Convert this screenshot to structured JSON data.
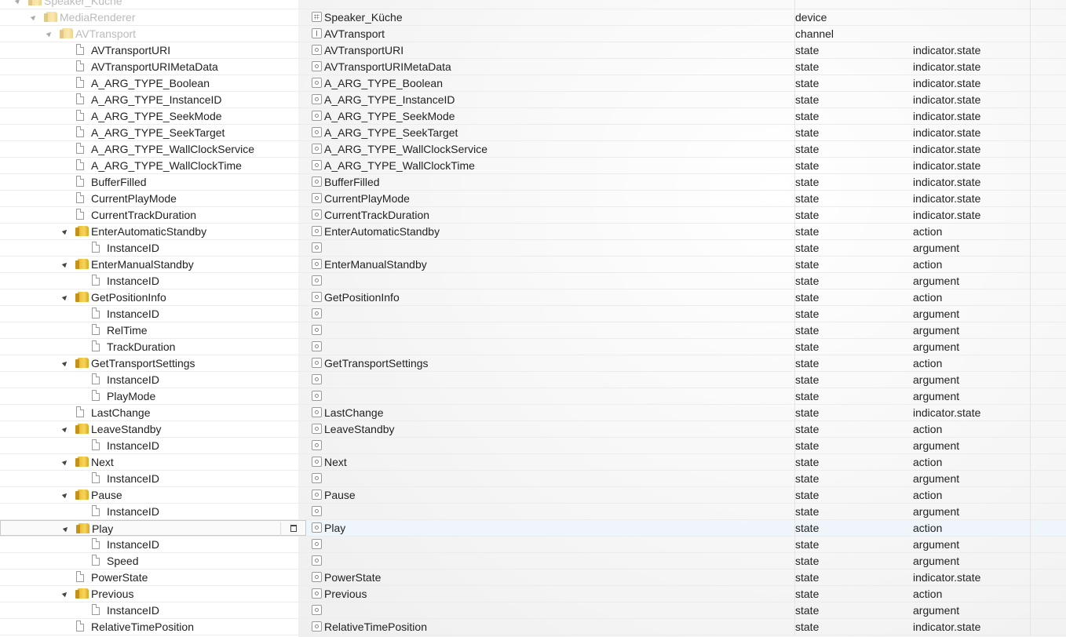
{
  "rows": [
    {
      "name": "Speaker_Küche",
      "object_name": "",
      "type": "",
      "role": "",
      "kind": "folder",
      "depth": 0,
      "expanded": true,
      "dim": true,
      "icon": "folder-icon",
      "oicon": ""
    },
    {
      "name": "MediaRenderer",
      "object_name": "Speaker_Küche",
      "type": "device",
      "role": "",
      "kind": "folder",
      "depth": 1,
      "expanded": true,
      "dim": true,
      "icon": "folder-icon",
      "oicon": "device"
    },
    {
      "name": "AVTransport",
      "object_name": "AVTransport",
      "type": "channel",
      "role": "",
      "kind": "folder",
      "depth": 2,
      "expanded": true,
      "dim": true,
      "icon": "folder-icon",
      "oicon": "channel"
    },
    {
      "name": "AVTransportURI",
      "object_name": "AVTransportURI",
      "type": "state",
      "role": "indicator.state",
      "kind": "file",
      "depth": 3
    },
    {
      "name": "AVTransportURIMetaData",
      "object_name": "AVTransportURIMetaData",
      "type": "state",
      "role": "indicator.state",
      "kind": "file",
      "depth": 3
    },
    {
      "name": "A_ARG_TYPE_Boolean",
      "object_name": "A_ARG_TYPE_Boolean",
      "type": "state",
      "role": "indicator.state",
      "kind": "file",
      "depth": 3
    },
    {
      "name": "A_ARG_TYPE_InstanceID",
      "object_name": "A_ARG_TYPE_InstanceID",
      "type": "state",
      "role": "indicator.state",
      "kind": "file",
      "depth": 3
    },
    {
      "name": "A_ARG_TYPE_SeekMode",
      "object_name": "A_ARG_TYPE_SeekMode",
      "type": "state",
      "role": "indicator.state",
      "kind": "file",
      "depth": 3
    },
    {
      "name": "A_ARG_TYPE_SeekTarget",
      "object_name": "A_ARG_TYPE_SeekTarget",
      "type": "state",
      "role": "indicator.state",
      "kind": "file",
      "depth": 3
    },
    {
      "name": "A_ARG_TYPE_WallClockService",
      "object_name": "A_ARG_TYPE_WallClockService",
      "type": "state",
      "role": "indicator.state",
      "kind": "file",
      "depth": 3
    },
    {
      "name": "A_ARG_TYPE_WallClockTime",
      "object_name": "A_ARG_TYPE_WallClockTime",
      "type": "state",
      "role": "indicator.state",
      "kind": "file",
      "depth": 3
    },
    {
      "name": "BufferFilled",
      "object_name": "BufferFilled",
      "type": "state",
      "role": "indicator.state",
      "kind": "file",
      "depth": 3
    },
    {
      "name": "CurrentPlayMode",
      "object_name": "CurrentPlayMode",
      "type": "state",
      "role": "indicator.state",
      "kind": "file",
      "depth": 3
    },
    {
      "name": "CurrentTrackDuration",
      "object_name": "CurrentTrackDuration",
      "type": "state",
      "role": "indicator.state",
      "kind": "file",
      "depth": 3
    },
    {
      "name": "EnterAutomaticStandby",
      "object_name": "EnterAutomaticStandby",
      "type": "state",
      "role": "action",
      "kind": "folder",
      "depth": 3,
      "expanded": true
    },
    {
      "name": "InstanceID",
      "object_name": "",
      "type": "state",
      "role": "argument",
      "kind": "file",
      "depth": 4
    },
    {
      "name": "EnterManualStandby",
      "object_name": "EnterManualStandby",
      "type": "state",
      "role": "action",
      "kind": "folder",
      "depth": 3,
      "expanded": true
    },
    {
      "name": "InstanceID",
      "object_name": "",
      "type": "state",
      "role": "argument",
      "kind": "file",
      "depth": 4
    },
    {
      "name": "GetPositionInfo",
      "object_name": "GetPositionInfo",
      "type": "state",
      "role": "action",
      "kind": "folder",
      "depth": 3,
      "expanded": true
    },
    {
      "name": "InstanceID",
      "object_name": "",
      "type": "state",
      "role": "argument",
      "kind": "file",
      "depth": 4
    },
    {
      "name": "RelTime",
      "object_name": "",
      "type": "state",
      "role": "argument",
      "kind": "file",
      "depth": 4
    },
    {
      "name": "TrackDuration",
      "object_name": "",
      "type": "state",
      "role": "argument",
      "kind": "file",
      "depth": 4
    },
    {
      "name": "GetTransportSettings",
      "object_name": "GetTransportSettings",
      "type": "state",
      "role": "action",
      "kind": "folder",
      "depth": 3,
      "expanded": true
    },
    {
      "name": "InstanceID",
      "object_name": "",
      "type": "state",
      "role": "argument",
      "kind": "file",
      "depth": 4
    },
    {
      "name": "PlayMode",
      "object_name": "",
      "type": "state",
      "role": "argument",
      "kind": "file",
      "depth": 4
    },
    {
      "name": "LastChange",
      "object_name": "LastChange",
      "type": "state",
      "role": "indicator.state",
      "kind": "file",
      "depth": 3
    },
    {
      "name": "LeaveStandby",
      "object_name": "LeaveStandby",
      "type": "state",
      "role": "action",
      "kind": "folder",
      "depth": 3,
      "expanded": true
    },
    {
      "name": "InstanceID",
      "object_name": "",
      "type": "state",
      "role": "argument",
      "kind": "file",
      "depth": 4
    },
    {
      "name": "Next",
      "object_name": "Next",
      "type": "state",
      "role": "action",
      "kind": "folder",
      "depth": 3,
      "expanded": true
    },
    {
      "name": "InstanceID",
      "object_name": "",
      "type": "state",
      "role": "argument",
      "kind": "file",
      "depth": 4
    },
    {
      "name": "Pause",
      "object_name": "Pause",
      "type": "state",
      "role": "action",
      "kind": "folder",
      "depth": 3,
      "expanded": true
    },
    {
      "name": "InstanceID",
      "object_name": "",
      "type": "state",
      "role": "argument",
      "kind": "file",
      "depth": 4
    },
    {
      "name": "Play",
      "object_name": "Play",
      "type": "state",
      "role": "action",
      "kind": "folder",
      "depth": 3,
      "expanded": true,
      "selected": true
    },
    {
      "name": "InstanceID",
      "object_name": "",
      "type": "state",
      "role": "argument",
      "kind": "file",
      "depth": 4
    },
    {
      "name": "Speed",
      "object_name": "",
      "type": "state",
      "role": "argument",
      "kind": "file",
      "depth": 4
    },
    {
      "name": "PowerState",
      "object_name": "PowerState",
      "type": "state",
      "role": "indicator.state",
      "kind": "file",
      "depth": 3
    },
    {
      "name": "Previous",
      "object_name": "Previous",
      "type": "state",
      "role": "action",
      "kind": "folder",
      "depth": 3,
      "expanded": true
    },
    {
      "name": "InstanceID",
      "object_name": "",
      "type": "state",
      "role": "argument",
      "kind": "file",
      "depth": 4
    },
    {
      "name": "RelativeTimePosition",
      "object_name": "RelativeTimePosition",
      "type": "state",
      "role": "indicator.state",
      "kind": "file",
      "depth": 3
    }
  ],
  "icons": {
    "folder": "folder-icon",
    "file": "file-icon",
    "expand": "triangle-expanded-icon",
    "state": "state-icon",
    "channel": "channel-icon",
    "device": "device-icon",
    "delete": "trash-icon"
  },
  "colors": {
    "dim_text": "#bbbbbb",
    "folder": "#f2c744",
    "selected_row": "#eef6fc"
  }
}
